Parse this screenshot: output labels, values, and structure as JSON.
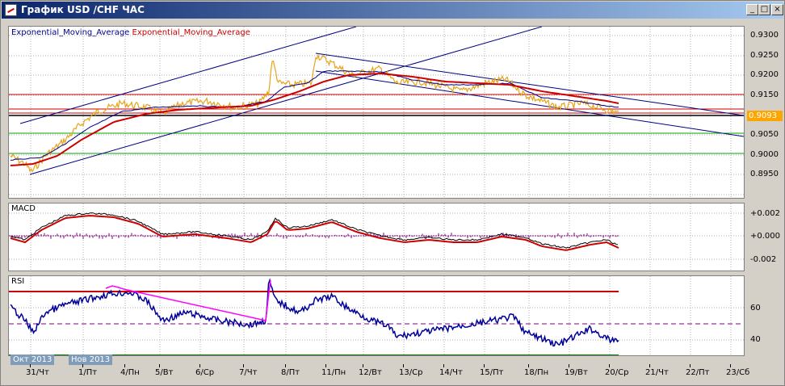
{
  "window": {
    "title": "График USD /CHF ЧАС",
    "buttons": {
      "minimize": "_",
      "maximize": "□",
      "close": "×"
    }
  },
  "main_chart": {
    "legend_1": "Exponential_Moving_Average",
    "legend_2": "Exponential_Moving_Average",
    "y_ticks": [
      "0.9300",
      "0.9250",
      "0.9200",
      "0.9150",
      "0.9093",
      "0.9050",
      "0.9000",
      "0.8950"
    ],
    "current_price": "0.9093"
  },
  "macd": {
    "label": "MACD",
    "y_ticks": [
      "+0.002",
      "+0.000",
      "-0.002"
    ]
  },
  "rsi": {
    "label": "RSI",
    "y_ticks": [
      "60",
      "40"
    ]
  },
  "months": [
    "Окт 2013",
    "Нов 2013"
  ],
  "x_ticks": [
    "31/Чт",
    "1/Пт",
    "4/Пн",
    "5/Вт",
    "6/Ср",
    "7/Чт",
    "8/Пт",
    "11/Пн",
    "12/Вт",
    "13/Ср",
    "14/Чт",
    "15/Пт",
    "18/Пн",
    "19/Вт",
    "20/Ср",
    "21/Чт",
    "22/Пт",
    "23/Сб"
  ],
  "colors": {
    "price": "#e8a317",
    "ema_fast": "#00008b",
    "ema_slow": "#cc0000",
    "rsi": "#000099",
    "rsi_overbought": "#ff00ff",
    "grid": "#a0a0a0",
    "channel": "#000080"
  }
}
